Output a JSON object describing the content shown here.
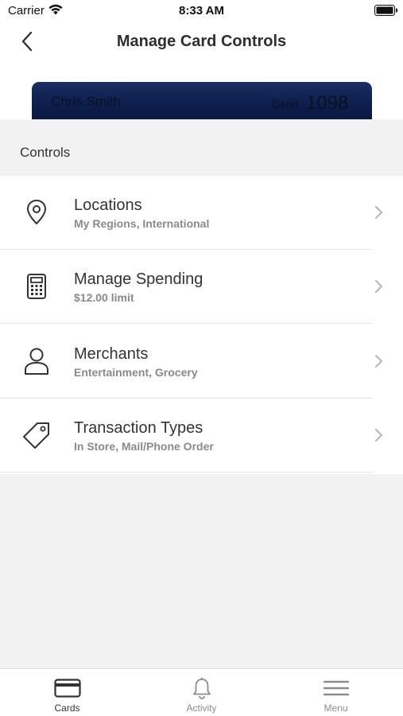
{
  "status_bar": {
    "carrier": "Carrier",
    "time": "8:33 AM",
    "icons": [
      "wifi-icon",
      "battery-icon"
    ]
  },
  "header": {
    "title": "Manage Card Controls",
    "back_icon": "chevron-left-icon"
  },
  "card": {
    "holder": "Chris Smith",
    "type": "Debit",
    "last4": "1098"
  },
  "section": {
    "label": "Controls"
  },
  "controls": [
    {
      "title": "Locations",
      "subtitle": "My Regions, International",
      "icon": "location-pin-icon"
    },
    {
      "title": "Manage Spending",
      "subtitle": "$12.00 limit",
      "icon": "calculator-icon"
    },
    {
      "title": "Merchants",
      "subtitle": "Entertainment, Grocery",
      "icon": "person-icon"
    },
    {
      "title": "Transaction Types",
      "subtitle": "In Store, Mail/Phone Order",
      "icon": "tag-icon"
    }
  ],
  "tab_bar": {
    "tabs": [
      {
        "label": "Cards",
        "icon": "card-icon",
        "active": true
      },
      {
        "label": "Activity",
        "icon": "bell-icon",
        "active": false
      },
      {
        "label": "Menu",
        "icon": "menu-icon",
        "active": false
      }
    ]
  },
  "colors": {
    "background": "#f2f2f2",
    "card_navy": "#0d1f4d",
    "text_primary": "#333333",
    "text_secondary": "#8a8a8a"
  }
}
